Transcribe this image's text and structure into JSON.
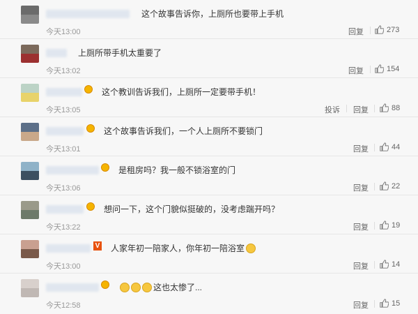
{
  "actions": {
    "reply_label": "回复",
    "report_label": "投诉"
  },
  "comments": [
    {
      "text": "这个故事告诉你，上厕所也要带上手机",
      "time": "今天13:00",
      "likes": "273",
      "emojis": 0
    },
    {
      "text": "上厕所带手机太重要了",
      "time": "今天13:02",
      "likes": "154",
      "emojis": 0
    },
    {
      "text": "这个教训告诉我们，上厕所一定要带手机！",
      "time": "今天13:05",
      "likes": "88",
      "emojis": 0
    },
    {
      "text": "这个故事告诉我们，一个人上厕所不要锁门",
      "time": "今天13:01",
      "likes": "44",
      "emojis": 0
    },
    {
      "text": "是租房吗？我一般不锁浴室的门",
      "time": "今天13:06",
      "likes": "22",
      "emojis": 0
    },
    {
      "text": "想问一下，这个门貌似挺破的，没考虑踹开吗？",
      "time": "今天13:22",
      "likes": "19",
      "emojis": 0
    },
    {
      "text": "人家年初一陪家人，你年初一陪浴室",
      "time": "今天13:00",
      "likes": "14",
      "emojis": 1
    },
    {
      "text": "这也太惨了...",
      "time": "今天12:58",
      "likes": "15",
      "emojis": 3
    }
  ],
  "colors": {
    "accent_emoji": "#f5b400",
    "vip_badge": "#e8520e"
  }
}
